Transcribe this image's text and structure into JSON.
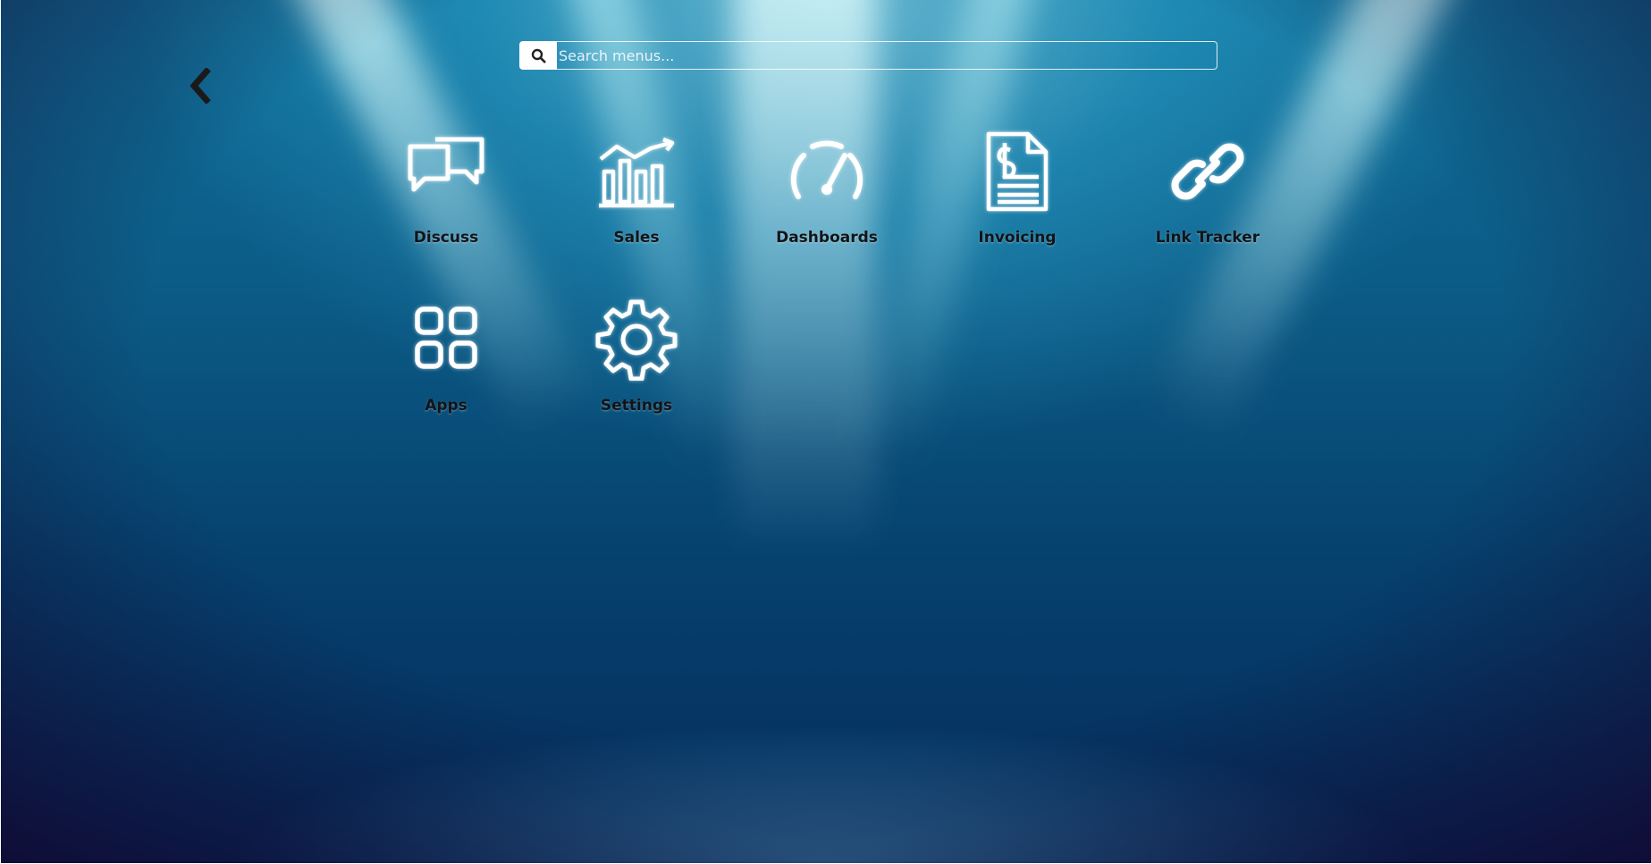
{
  "search": {
    "placeholder": "Search menus..."
  },
  "navigation": {
    "back_icon": "chevron-left-icon"
  },
  "apps": [
    {
      "label": "Discuss",
      "icon": "chat-bubbles-icon"
    },
    {
      "label": "Sales",
      "icon": "bar-chart-trend-icon"
    },
    {
      "label": "Dashboards",
      "icon": "speedometer-icon"
    },
    {
      "label": "Invoicing",
      "icon": "invoice-document-icon"
    },
    {
      "label": "Link Tracker",
      "icon": "link-icon"
    },
    {
      "label": "Apps",
      "icon": "grid-icon"
    },
    {
      "label": "Settings",
      "icon": "gear-icon"
    }
  ],
  "colors": {
    "background": "#0b5a85",
    "icon": "#ffffff",
    "label": "#111418"
  }
}
